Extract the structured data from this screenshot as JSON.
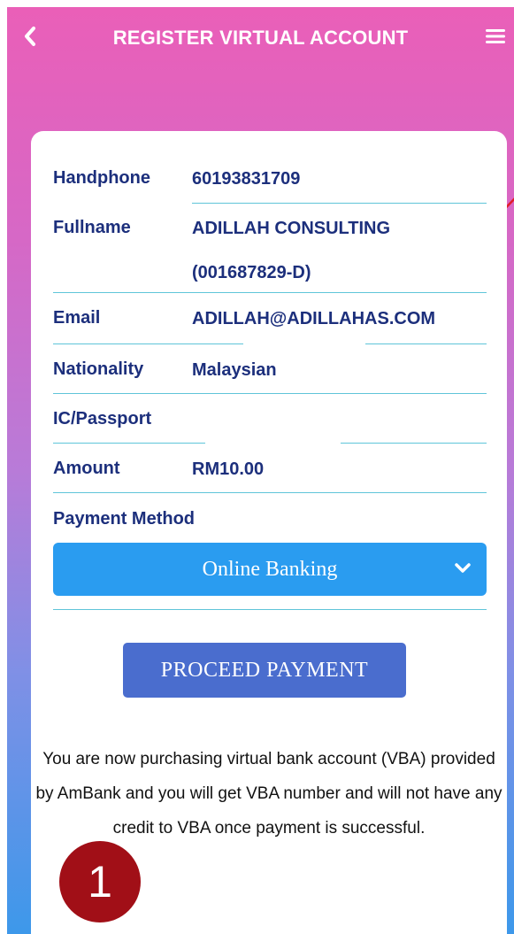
{
  "header": {
    "title": "REGISTER VIRTUAL ACCOUNT",
    "back_icon": "chevron-left-icon",
    "menu_icon": "hamburger-menu-icon"
  },
  "form": {
    "handphone": {
      "label": "Handphone",
      "value": "60193831709"
    },
    "fullname": {
      "label": "Fullname",
      "value_line1": "ADILLAH CONSULTING",
      "value_line2": "(001687829-D)"
    },
    "email": {
      "label": "Email",
      "value": "ADILLAH@ADILLAHAS.COM"
    },
    "nationality": {
      "label": "Nationality",
      "value": "Malaysian"
    },
    "ic_passport": {
      "label": "IC/Passport",
      "value": ""
    },
    "amount": {
      "label": "Amount",
      "value": "RM10.00"
    },
    "payment_method": {
      "label": "Payment Method",
      "selected": "Online Banking"
    }
  },
  "actions": {
    "proceed_label": "PROCEED PAYMENT"
  },
  "note": "You are now purchasing virtual bank account (VBA) provided by AmBank and you will get VBA number and will not have any credit to VBA once payment is successful.",
  "annotation": {
    "step_number": "1",
    "colors": {
      "badge": "#a10f17",
      "arrow": "#e11d2a"
    }
  },
  "colors": {
    "label_text": "#1c2f7c",
    "underline": "#5fc5d9",
    "select_bg": "#2a9cf0",
    "button_bg": "#4a6dce"
  }
}
